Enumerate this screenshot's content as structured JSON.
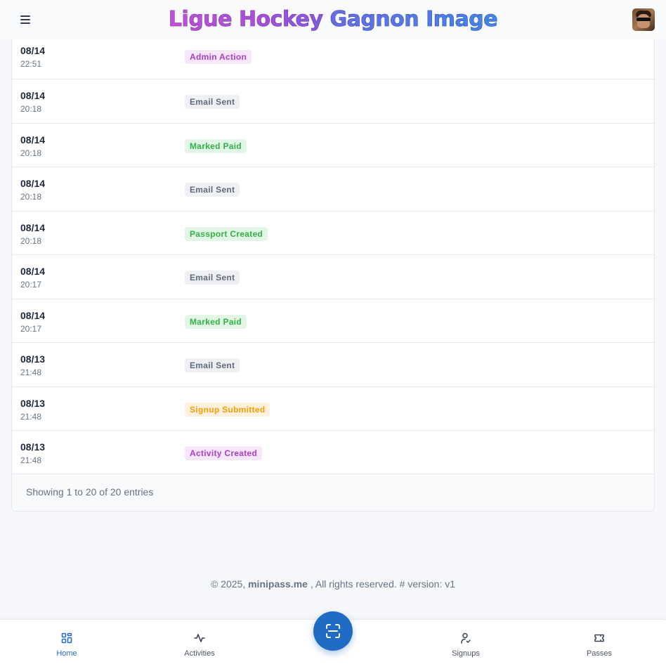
{
  "header": {
    "brand_part1": "Ligue Hockey",
    "brand_part2": "Gagnon Image",
    "menu_icon": "hamburger-menu-icon",
    "avatar_icon": "user-avatar"
  },
  "activity_log": [
    {
      "date": "08/14",
      "time": "22:51",
      "event": "Admin Action",
      "color": "purple"
    },
    {
      "date": "08/14",
      "time": "20:18",
      "event": "Email Sent",
      "color": "gray"
    },
    {
      "date": "08/14",
      "time": "20:18",
      "event": "Marked Paid",
      "color": "green"
    },
    {
      "date": "08/14",
      "time": "20:18",
      "event": "Email Sent",
      "color": "gray"
    },
    {
      "date": "08/14",
      "time": "20:18",
      "event": "Passport Created",
      "color": "green"
    },
    {
      "date": "08/14",
      "time": "20:17",
      "event": "Email Sent",
      "color": "gray"
    },
    {
      "date": "08/14",
      "time": "20:17",
      "event": "Marked Paid",
      "color": "green"
    },
    {
      "date": "08/13",
      "time": "21:48",
      "event": "Email Sent",
      "color": "gray"
    },
    {
      "date": "08/13",
      "time": "21:48",
      "event": "Signup Submitted",
      "color": "orange"
    },
    {
      "date": "08/13",
      "time": "21:48",
      "event": "Activity Created",
      "color": "purple"
    }
  ],
  "table_footer": {
    "entries_text": "Showing 1 to 20 of 20 entries"
  },
  "footer": {
    "copyright_prefix": "© 2025,",
    "site": "minipass.me",
    "copyright_suffix": ", All rights reserved. # version: v1"
  },
  "bottom_nav": {
    "home": "Home",
    "activities": "Activities",
    "scan_icon": "qr-scan-icon",
    "signups": "Signups",
    "passes": "Passes"
  },
  "colors": {
    "accent": "#206bc4",
    "badge_purple": "#ae3ec9",
    "badge_green": "#2fb344",
    "badge_orange": "#f59f00",
    "badge_gray": "#5f6b7a"
  }
}
